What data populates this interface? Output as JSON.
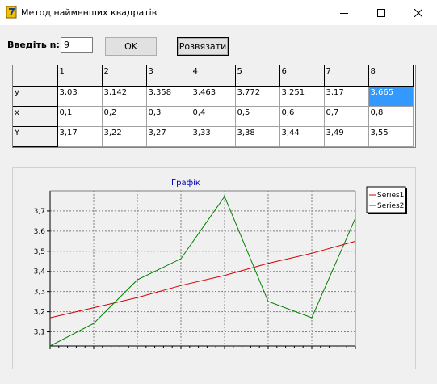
{
  "window": {
    "title": "Метод найменших квадратів",
    "controls": [
      "minimize-icon",
      "maximize-icon",
      "close-icon"
    ]
  },
  "form": {
    "n_label": "Введіть n:",
    "n_value": "9",
    "ok_label": "OK",
    "solve_label": "Розвязати"
  },
  "table": {
    "header": [
      "",
      "1",
      "2",
      "3",
      "4",
      "5",
      "6",
      "7",
      "8"
    ],
    "rows": [
      {
        "label": "y",
        "cells": [
          "3,03",
          "3,142",
          "3,358",
          "3,463",
          "3,772",
          "3,251",
          "3,17",
          "3,665"
        ]
      },
      {
        "label": "x",
        "cells": [
          "0,1",
          "0,2",
          "0,3",
          "0,4",
          "0,5",
          "0,6",
          "0,7",
          "0,8"
        ]
      },
      {
        "label": "Y",
        "cells": [
          "3,17",
          "3,22",
          "3,27",
          "3,33",
          "3,38",
          "3,44",
          "3,49",
          "3,55"
        ]
      }
    ],
    "selected_cell": {
      "row": 0,
      "col": 8
    },
    "selection_color": "#3399ff"
  },
  "chart_data": {
    "type": "line",
    "title": "Графік",
    "x": [
      0.1,
      0.2,
      0.3,
      0.4,
      0.5,
      0.6,
      0.7,
      0.8
    ],
    "xlim": [
      0.1,
      0.8
    ],
    "ylim": [
      3.03,
      3.8
    ],
    "yticks": [
      "3,1",
      "3,2",
      "3,3",
      "3,4",
      "3,5",
      "3,6",
      "3,7"
    ],
    "grid": true,
    "legend_position": "top-right",
    "series": [
      {
        "name": "Series1",
        "color": "#d40000",
        "values": [
          3.17,
          3.22,
          3.27,
          3.33,
          3.38,
          3.44,
          3.49,
          3.55
        ]
      },
      {
        "name": "Series2",
        "color": "#008000",
        "values": [
          3.03,
          3.142,
          3.358,
          3.463,
          3.772,
          3.251,
          3.17,
          3.665
        ]
      }
    ]
  }
}
